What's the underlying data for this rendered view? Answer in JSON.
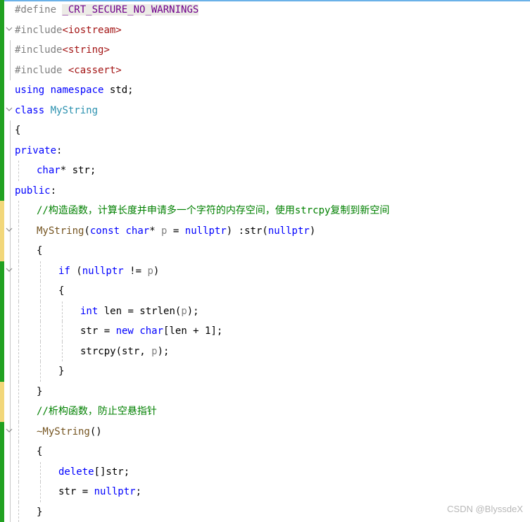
{
  "lines": [
    [
      {
        "t": "#define ",
        "c": "pp"
      },
      {
        "t": "_CRT_SECURE_NO_WARNINGS",
        "c": "macro"
      }
    ],
    [
      {
        "t": "#include",
        "c": "pp"
      },
      {
        "t": "<iostream>",
        "c": "str"
      }
    ],
    [
      {
        "t": "#include",
        "c": "pp"
      },
      {
        "t": "<string>",
        "c": "str"
      }
    ],
    [
      {
        "t": "#include ",
        "c": "pp"
      },
      {
        "t": "<cassert>",
        "c": "str"
      }
    ],
    [
      {
        "t": "using",
        "c": "kw"
      },
      {
        "t": " ",
        "c": "pl"
      },
      {
        "t": "namespace",
        "c": "kw"
      },
      {
        "t": " std;",
        "c": "pl"
      }
    ],
    [
      {
        "t": "class",
        "c": "kw"
      },
      {
        "t": " ",
        "c": "pl"
      },
      {
        "t": "MyString",
        "c": "ty"
      }
    ],
    [
      {
        "t": "{",
        "c": "pl"
      }
    ],
    [
      {
        "t": "private",
        "c": "kw"
      },
      {
        "t": ":",
        "c": "pl"
      }
    ],
    [
      {
        "t": "char",
        "c": "kw"
      },
      {
        "t": "* str;",
        "c": "pl"
      }
    ],
    [
      {
        "t": "public",
        "c": "kw"
      },
      {
        "t": ":",
        "c": "pl"
      }
    ],
    [
      {
        "t": "//构造函数，计算长度并申请多一个字符的内存空间，使用strcpy复制到新空间",
        "c": "cm"
      }
    ],
    [
      {
        "t": "MyString",
        "c": "fn"
      },
      {
        "t": "(",
        "c": "pl"
      },
      {
        "t": "const",
        "c": "kw"
      },
      {
        "t": " ",
        "c": "pl"
      },
      {
        "t": "char",
        "c": "kw"
      },
      {
        "t": "* ",
        "c": "pl"
      },
      {
        "t": "p",
        "c": "pm"
      },
      {
        "t": " = ",
        "c": "pl"
      },
      {
        "t": "nullptr",
        "c": "kw"
      },
      {
        "t": ") :str(",
        "c": "pl"
      },
      {
        "t": "nullptr",
        "c": "kw"
      },
      {
        "t": ")",
        "c": "pl"
      }
    ],
    [
      {
        "t": "{",
        "c": "pl"
      }
    ],
    [
      {
        "t": "if",
        "c": "kw"
      },
      {
        "t": " (",
        "c": "pl"
      },
      {
        "t": "nullptr",
        "c": "kw"
      },
      {
        "t": " != ",
        "c": "pl"
      },
      {
        "t": "p",
        "c": "pm"
      },
      {
        "t": ")",
        "c": "pl"
      }
    ],
    [
      {
        "t": "{",
        "c": "pl"
      }
    ],
    [
      {
        "t": "int",
        "c": "kw"
      },
      {
        "t": " len = strlen(",
        "c": "pl"
      },
      {
        "t": "p",
        "c": "pm"
      },
      {
        "t": ");",
        "c": "pl"
      }
    ],
    [
      {
        "t": "str = ",
        "c": "pl"
      },
      {
        "t": "new",
        "c": "kw"
      },
      {
        "t": " ",
        "c": "pl"
      },
      {
        "t": "char",
        "c": "kw"
      },
      {
        "t": "[len + 1];",
        "c": "pl"
      }
    ],
    [
      {
        "t": "strcpy(str, ",
        "c": "pl"
      },
      {
        "t": "p",
        "c": "pm"
      },
      {
        "t": ");",
        "c": "pl"
      }
    ],
    [
      {
        "t": "}",
        "c": "pl"
      }
    ],
    [
      {
        "t": "}",
        "c": "pl"
      }
    ],
    [
      {
        "t": "//析构函数，防止空悬指针",
        "c": "cm"
      }
    ],
    [
      {
        "t": "~MyString",
        "c": "fn"
      },
      {
        "t": "()",
        "c": "pl"
      }
    ],
    [
      {
        "t": "{",
        "c": "pl"
      }
    ],
    [
      {
        "t": "delete",
        "c": "kw"
      },
      {
        "t": "[]str;",
        "c": "pl"
      }
    ],
    [
      {
        "t": "str = ",
        "c": "pl"
      },
      {
        "t": "nullptr",
        "c": "kw"
      },
      {
        "t": ";",
        "c": "pl"
      }
    ],
    [
      {
        "t": "}",
        "c": "pl"
      }
    ]
  ],
  "watermark": "CSDN @BlyssdeX"
}
